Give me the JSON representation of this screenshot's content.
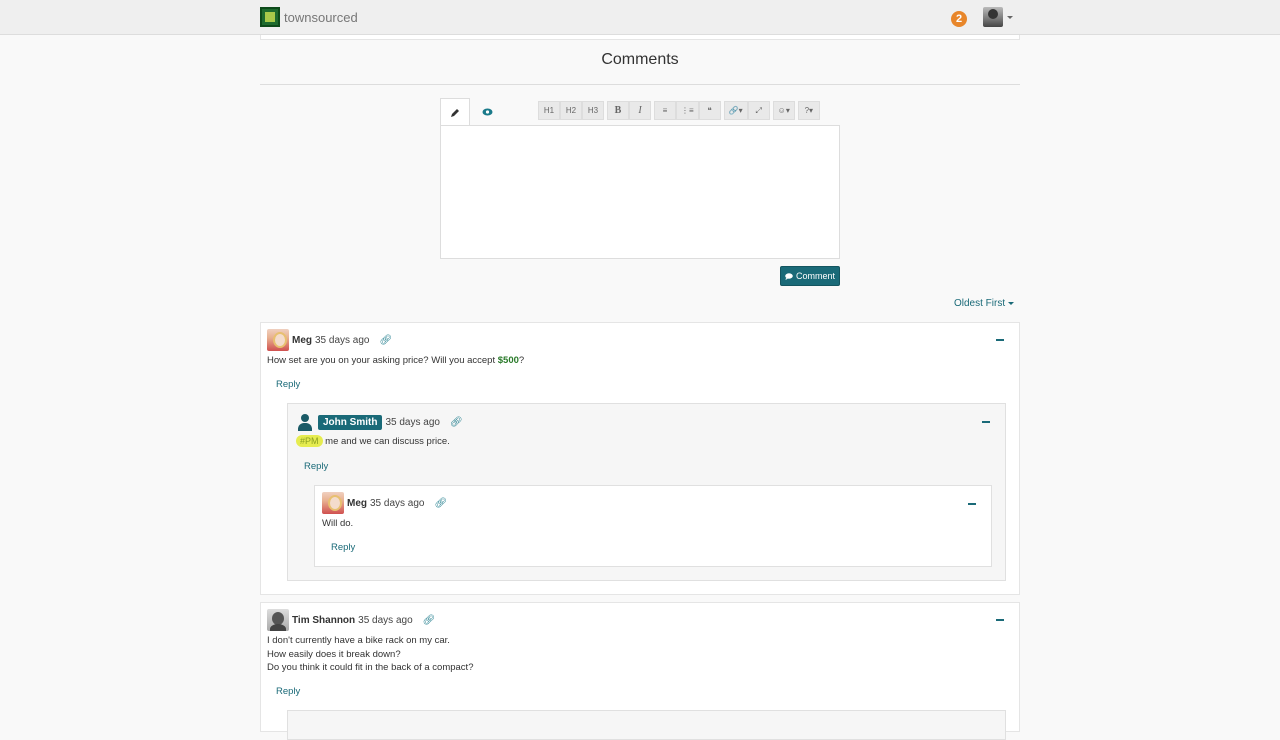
{
  "navbar": {
    "brand": "townsourced",
    "notification_count": "2"
  },
  "comments_title": "Comments",
  "editor": {
    "toolbar": [
      [
        "H1",
        "H2",
        "H3"
      ],
      [
        "B",
        "I"
      ],
      [
        "≡",
        "⋮≡",
        "❝"
      ],
      [
        "🔗▾",
        "⤢"
      ],
      [
        "☺▾"
      ],
      [
        "?▾"
      ]
    ]
  },
  "comment_button": "Comment",
  "sort_label": "Oldest First",
  "comments": [
    {
      "author": "Meg",
      "time": "35 days ago",
      "body_pre": "How set are you on your asking price? Will you accept ",
      "body_price": "$500",
      "body_post": "?",
      "reply": "Reply",
      "children": [
        {
          "author": "John Smith",
          "time": "35 days ago",
          "hashtag": "#PM",
          "body": " me and we can discuss price.",
          "reply": "Reply",
          "children": [
            {
              "author": "Meg",
              "time": "35 days ago",
              "body": "Will do.",
              "reply": "Reply"
            }
          ]
        }
      ]
    },
    {
      "author": "Tim Shannon",
      "time": "35 days ago",
      "lines": [
        "I don't currently have a bike rack on my car.",
        "How easily does it break down?",
        "Do you think it could fit in the back of a compact?"
      ],
      "reply": "Reply"
    }
  ]
}
